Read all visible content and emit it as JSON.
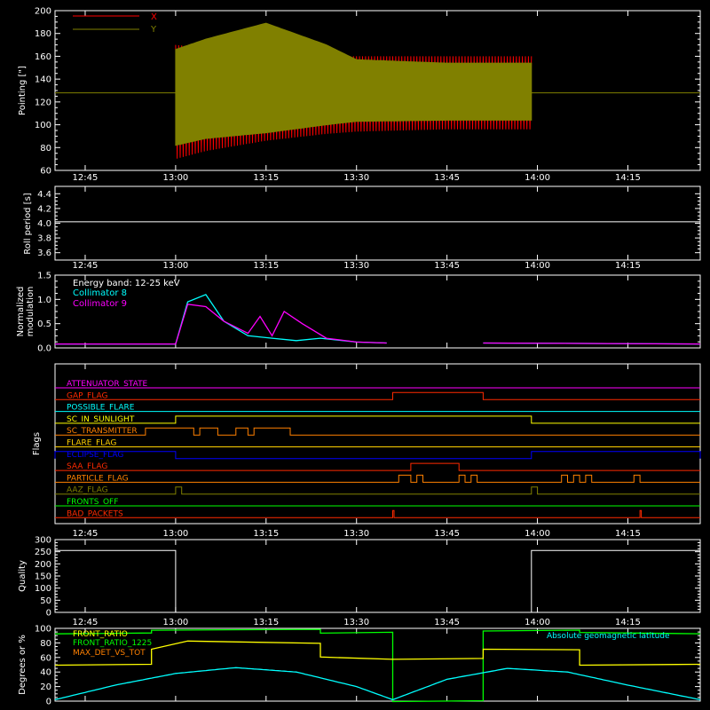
{
  "time_ticks": [
    "12:45",
    "13:00",
    "13:15",
    "13:30",
    "13:45",
    "14:00",
    "14:15"
  ],
  "chart_data": [
    {
      "type": "line",
      "name": "pointing",
      "ylabel": "Pointing [\"]",
      "ylim": [
        60,
        200
      ],
      "yticks": [
        "60",
        "80",
        "100",
        "120",
        "140",
        "160",
        "180",
        "200"
      ],
      "xlim": [
        "12:40",
        "14:27"
      ],
      "legend": [
        {
          "name": "X",
          "color": "#ff0000"
        },
        {
          "name": "Y",
          "color": "#808000"
        }
      ],
      "series": [
        {
          "name": "X",
          "color": "#ff0000",
          "x": [
            "13:00",
            "13:05",
            "13:15",
            "13:25",
            "13:30",
            "13:45",
            "13:59"
          ],
          "center": [
            120,
            122,
            124,
            126,
            127,
            128,
            128
          ],
          "amplitude": [
            50,
            45,
            38,
            34,
            33,
            32,
            32
          ]
        },
        {
          "name": "Y",
          "color": "#808000",
          "x": [
            "13:00",
            "13:05",
            "13:15",
            "13:25",
            "13:30",
            "13:45",
            "13:59"
          ],
          "upper": [
            166,
            175,
            189,
            170,
            157,
            154,
            154
          ],
          "lower": [
            82,
            88,
            93,
            100,
            103,
            104,
            104
          ]
        }
      ],
      "baseline": 128
    },
    {
      "type": "line",
      "name": "roll-period",
      "ylabel": "Roll period [s]",
      "ylim": [
        3.5,
        4.5
      ],
      "yticks": [
        "3.6",
        "3.8",
        "4.0",
        "4.2",
        "4.4"
      ],
      "series": [
        {
          "name": "Roll period",
          "color": "#ffffff",
          "x": [
            "12:40",
            "14:27"
          ],
          "y": [
            4.02,
            4.02
          ]
        }
      ]
    },
    {
      "type": "line",
      "name": "modulation",
      "ylabel": "Normalized modulation",
      "ylim": [
        0,
        1.5
      ],
      "yticks": [
        "0.0",
        "0.5",
        "1.0",
        "1.5"
      ],
      "annotation": "Energy band: 12-25 keV",
      "legend": [
        {
          "name": "Collimator 8",
          "color": "#00ffff"
        },
        {
          "name": "Collimator 9",
          "color": "#ff00ff"
        }
      ],
      "series": [
        {
          "name": "Collimator 8",
          "color": "#00ffff",
          "x": [
            "12:40",
            "13:00",
            "13:02",
            "13:05",
            "13:08",
            "13:12",
            "13:16",
            "13:20",
            "13:24",
            "13:30",
            "13:35",
            "13:36",
            "13:51",
            "14:27"
          ],
          "y": [
            0.08,
            0.08,
            0.95,
            1.1,
            0.55,
            0.25,
            0.2,
            0.15,
            0.2,
            0.12,
            0.1,
            null,
            0.1,
            0.08
          ]
        },
        {
          "name": "Collimator 9",
          "color": "#ff00ff",
          "x": [
            "12:40",
            "13:00",
            "13:02",
            "13:05",
            "13:08",
            "13:12",
            "13:14",
            "13:16",
            "13:18",
            "13:21",
            "13:25",
            "13:30",
            "13:35",
            "13:36",
            "13:51",
            "14:27"
          ],
          "y": [
            0.08,
            0.08,
            0.9,
            0.85,
            0.55,
            0.3,
            0.65,
            0.25,
            0.75,
            0.5,
            0.2,
            0.12,
            0.1,
            null,
            0.1,
            0.08
          ]
        }
      ]
    },
    {
      "type": "line",
      "name": "flags",
      "ylabel": "Flags",
      "flags": [
        {
          "name": "ATTENUATOR_STATE",
          "color": "#ff00ff",
          "high": []
        },
        {
          "name": "GAP_FLAG",
          "color": "#ff2a00",
          "high": [
            [
              "13:36",
              "13:51"
            ]
          ]
        },
        {
          "name": "POSSIBLE_FLARE",
          "color": "#00ffff",
          "high": []
        },
        {
          "name": "SC_IN_SUNLIGHT",
          "color": "#ffff00",
          "high": [
            [
              "13:00",
              "13:59"
            ]
          ]
        },
        {
          "name": "SC_TRANSMITTER",
          "color": "#ff8000",
          "high": [
            [
              "12:55",
              "13:03"
            ],
            [
              "13:04",
              "13:07"
            ],
            [
              "13:10",
              "13:12"
            ],
            [
              "13:13",
              "13:19"
            ]
          ]
        },
        {
          "name": "FLARE_FLAG",
          "color": "#ffd000",
          "high": []
        },
        {
          "name": "ECLIPSE_FLAG",
          "color": "#0000ff",
          "high": [
            [
              "12:40",
              "13:00"
            ],
            [
              "13:59",
              "14:27"
            ]
          ]
        },
        {
          "name": "SAA_FLAG",
          "color": "#ff2a00",
          "high": [
            [
              "13:39",
              "13:47"
            ]
          ]
        },
        {
          "name": "PARTICLE_FLAG",
          "color": "#ff8000",
          "high": [
            [
              "13:37",
              "13:39"
            ],
            [
              "13:40",
              "13:41"
            ],
            [
              "13:47",
              "13:48"
            ],
            [
              "13:49",
              "13:50"
            ],
            [
              "14:04",
              "14:05"
            ],
            [
              "14:06",
              "14:07"
            ],
            [
              "14:08",
              "14:09"
            ],
            [
              "14:16",
              "14:17"
            ]
          ]
        },
        {
          "name": "AAZ_FLAG",
          "color": "#808000",
          "high": [
            [
              "13:00",
              "13:01"
            ],
            [
              "13:59",
              "14:00"
            ]
          ]
        },
        {
          "name": "FRONTS_OFF",
          "color": "#00ff00",
          "high": []
        },
        {
          "name": "BAD_PACKETS",
          "color": "#ff2a00",
          "high": [
            [
              "13:36",
              "13:36"
            ],
            [
              "14:17",
              "14:17"
            ]
          ]
        }
      ]
    },
    {
      "type": "line",
      "name": "quality",
      "ylabel": "Quality",
      "ylim": [
        0,
        300
      ],
      "yticks": [
        "0",
        "50",
        "100",
        "150",
        "200",
        "250",
        "300"
      ],
      "series": [
        {
          "name": "Quality",
          "color": "#ffffff",
          "x": [
            "12:40",
            "13:00",
            "13:00",
            "13:59",
            "13:59",
            "14:27"
          ],
          "y": [
            255,
            255,
            0,
            0,
            255,
            255
          ]
        }
      ]
    },
    {
      "type": "line",
      "name": "ratios",
      "ylabel": "Degrees or %",
      "ylim": [
        0,
        100
      ],
      "yticks": [
        "0",
        "20",
        "40",
        "60",
        "80",
        "100"
      ],
      "legend": [
        {
          "name": "FRONT_RATIO",
          "color": "#ffff00"
        },
        {
          "name": "FRONT_RATIO_1225",
          "color": "#00ff00"
        },
        {
          "name": "MAX_DET_VS_TOT",
          "color": "#ff8000"
        }
      ],
      "annotation": "Absolute geomagnetic latitude",
      "annotation_color": "#00ffff",
      "series": [
        {
          "name": "FRONT_RATIO_1225",
          "color": "#00ff00",
          "x": [
            "12:40",
            "12:56",
            "12:56",
            "13:24",
            "13:24",
            "13:36",
            "13:36",
            "13:51",
            "13:51",
            "14:07",
            "14:07",
            "14:27"
          ],
          "y": [
            93,
            93,
            98,
            98,
            94,
            94,
            0,
            0,
            97,
            97,
            95,
            92
          ]
        },
        {
          "name": "FRONT_RATIO",
          "color": "#ffff00",
          "x": [
            "12:40",
            "12:56",
            "12:56",
            "13:02",
            "13:24",
            "13:24",
            "13:36",
            "13:51",
            "13:51",
            "14:07",
            "14:07",
            "14:27"
          ],
          "y": [
            50,
            50,
            72,
            82,
            80,
            60,
            58,
            58,
            72,
            70,
            50,
            50
          ]
        },
        {
          "name": "Absolute geomagnetic latitude",
          "color": "#00ffff",
          "x": [
            "12:40",
            "12:50",
            "13:00",
            "13:10",
            "13:20",
            "13:30",
            "13:36",
            "13:45",
            "13:55",
            "14:05",
            "14:15",
            "14:27"
          ],
          "y": [
            2,
            22,
            38,
            46,
            40,
            20,
            2,
            30,
            45,
            40,
            22,
            2
          ]
        }
      ]
    }
  ]
}
